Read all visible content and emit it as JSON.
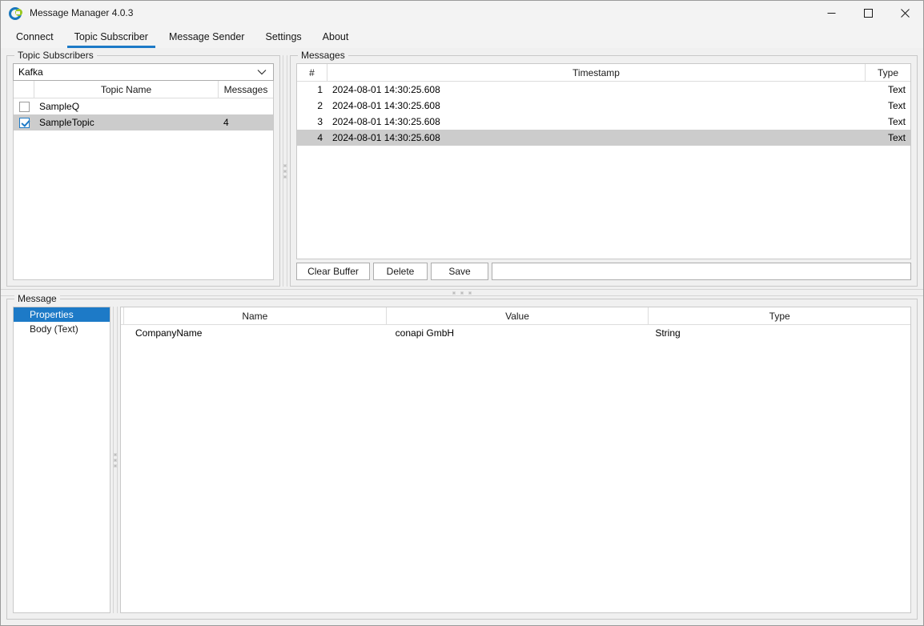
{
  "window": {
    "title": "Message Manager 4.0.3",
    "icon": "app-logo-icon",
    "controls": {
      "minimize": "minimize-icon",
      "maximize": "maximize-icon",
      "close": "close-icon"
    }
  },
  "menu": {
    "items": [
      {
        "label": "Connect",
        "active": false
      },
      {
        "label": "Topic Subscriber",
        "active": true
      },
      {
        "label": "Message Sender",
        "active": false
      },
      {
        "label": "Settings",
        "active": false
      },
      {
        "label": "About",
        "active": false
      }
    ]
  },
  "topic_subscribers": {
    "group_title": "Topic Subscribers",
    "broker_select": {
      "value": "Kafka",
      "chevron": "chevron-down-icon"
    },
    "columns": [
      "",
      "Topic Name",
      "Messages"
    ],
    "rows": [
      {
        "checked": false,
        "topic": "SampleQ",
        "messages": "",
        "selected": false
      },
      {
        "checked": true,
        "topic": "SampleTopic",
        "messages": "4",
        "selected": true
      }
    ]
  },
  "messages": {
    "group_title": "Messages",
    "columns": [
      "#",
      "Timestamp",
      "Type"
    ],
    "rows": [
      {
        "index": "1",
        "timestamp": "2024-08-01 14:30:25.608",
        "type": "Text",
        "selected": false
      },
      {
        "index": "2",
        "timestamp": "2024-08-01 14:30:25.608",
        "type": "Text",
        "selected": false
      },
      {
        "index": "3",
        "timestamp": "2024-08-01 14:30:25.608",
        "type": "Text",
        "selected": false
      },
      {
        "index": "4",
        "timestamp": "2024-08-01 14:30:25.608",
        "type": "Text",
        "selected": true
      }
    ],
    "buttons": [
      {
        "label": "Clear Buffer"
      },
      {
        "label": "Delete"
      },
      {
        "label": "Save"
      }
    ],
    "status_text": ""
  },
  "message_panel": {
    "group_title": "Message",
    "sections": [
      {
        "label": "Properties",
        "selected": true
      },
      {
        "label": "Body (Text)",
        "selected": false
      }
    ],
    "columns": [
      "",
      "Name",
      "Value",
      "Type"
    ],
    "rows": [
      {
        "name": "CompanyName",
        "value": "conapi GmbH",
        "type": "String"
      }
    ]
  },
  "splitters": {
    "vertical_top": "splitter-handle-vertical",
    "horizontal": "splitter-handle-horizontal",
    "vertical_bottom": "splitter-handle-vertical"
  },
  "colors": {
    "accent": "#1d7ac7",
    "selection_gray": "#cccccc",
    "window_bg": "#f0f0f0",
    "titlebar_bg": "#f3f3f3",
    "border": "#c9c9c9",
    "logo_blue": "#1877bd",
    "logo_green": "#9ac81f"
  }
}
